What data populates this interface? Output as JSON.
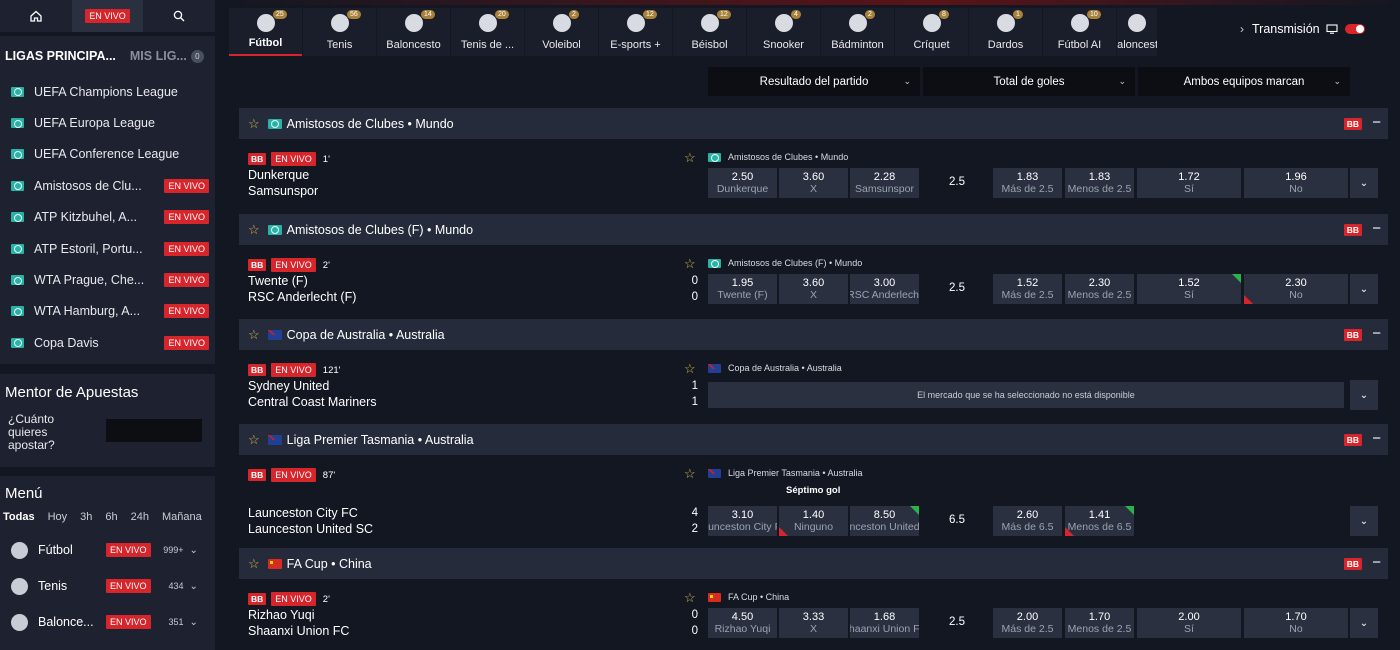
{
  "sidebar": {
    "topbar": {
      "live_label": "EN VIVO"
    },
    "tabs": {
      "active": "LIGAS PRINCIPA...",
      "inactive": "MIS LIG...",
      "count": "0"
    },
    "leagues": [
      {
        "name": "UEFA Champions League",
        "live": ""
      },
      {
        "name": "UEFA Europa League",
        "live": ""
      },
      {
        "name": "UEFA Conference League",
        "live": ""
      },
      {
        "name": "Amistosos de Clu...",
        "live": "EN VIVO"
      },
      {
        "name": "ATP Kitzbuhel, A...",
        "live": "EN VIVO"
      },
      {
        "name": "ATP Estoril, Portu...",
        "live": "EN VIVO"
      },
      {
        "name": "WTA Prague, Che...",
        "live": "EN VIVO"
      },
      {
        "name": "WTA Hamburg, A...",
        "live": "EN VIVO"
      },
      {
        "name": "Copa Davis",
        "live": "EN VIVO"
      }
    ],
    "mentor": {
      "title": "Mentor de Apuestas",
      "question": "¿Cuánto quieres apostar?",
      "value": ""
    },
    "menu": {
      "title": "Menú",
      "tabs": [
        "Todas",
        "Hoy",
        "3h",
        "6h",
        "24h",
        "Mañana"
      ],
      "items": [
        {
          "name": "Fútbol",
          "live": "EN VIVO",
          "count": "999+",
          "icon": "soccer-ball-icon"
        },
        {
          "name": "Tenis",
          "live": "EN VIVO",
          "count": "434",
          "icon": "tennis-ball-icon"
        },
        {
          "name": "Balonce...",
          "live": "EN VIVO",
          "count": "351",
          "icon": "basketball-icon"
        }
      ]
    }
  },
  "sports": [
    {
      "label": "Fútbol",
      "count": "25"
    },
    {
      "label": "Tenis",
      "count": "56"
    },
    {
      "label": "Baloncesto",
      "count": "14"
    },
    {
      "label": "Tenis de ...",
      "count": "20"
    },
    {
      "label": "Voleibol",
      "count": "2"
    },
    {
      "label": "E-sports +",
      "count": "12"
    },
    {
      "label": "Béisbol",
      "count": "12"
    },
    {
      "label": "Snooker",
      "count": "4"
    },
    {
      "label": "Bádminton",
      "count": "2"
    },
    {
      "label": "Críquet",
      "count": "8"
    },
    {
      "label": "Dardos",
      "count": "1"
    },
    {
      "label": "Fútbol AI",
      "count": "10"
    },
    {
      "label": "Baloncesto",
      "count": ""
    }
  ],
  "header": {
    "transmission": "Transmisión"
  },
  "markets": [
    "Resultado del partido",
    "Total de goles",
    "Ambos equipos marcan"
  ],
  "common": {
    "bb": "BB",
    "live": "EN VIVO"
  },
  "groups": [
    {
      "title": "Amistosos de Clubes • Mundo",
      "flag": "mundo",
      "match": {
        "time": "1'",
        "home": "Dunkerque",
        "away": "Samsunspor",
        "home_score": "",
        "away_score": "",
        "league": "Amistosos de Clubes • Mundo",
        "result": [
          {
            "odd": "2.50",
            "label": "Dunkerque"
          },
          {
            "odd": "3.60",
            "label": "X"
          },
          {
            "odd": "2.28",
            "label": "Samsunspor"
          }
        ],
        "total_line": "2.5",
        "totals": [
          {
            "odd": "1.83",
            "label": "Más de 2.5"
          },
          {
            "odd": "1.83",
            "label": "Menos de 2.5"
          }
        ],
        "btts": [
          {
            "odd": "1.72",
            "label": "Sí"
          },
          {
            "odd": "1.96",
            "label": "No"
          }
        ]
      }
    },
    {
      "title": "Amistosos de Clubes (F) • Mundo",
      "flag": "mundo",
      "match": {
        "time": "2'",
        "home": "Twente (F)",
        "away": "RSC Anderlecht (F)",
        "home_score": "0",
        "away_score": "0",
        "league": "Amistosos de Clubes (F) • Mundo",
        "result": [
          {
            "odd": "1.95",
            "label": "Twente (F)"
          },
          {
            "odd": "3.60",
            "label": "X"
          },
          {
            "odd": "3.00",
            "label": "RSC Anderlecht"
          }
        ],
        "total_line": "2.5",
        "totals": [
          {
            "odd": "1.52",
            "label": "Más de 2.5"
          },
          {
            "odd": "2.30",
            "label": "Menos de 2.5"
          }
        ],
        "btts": [
          {
            "odd": "1.52",
            "label": "Sí"
          },
          {
            "odd": "2.30",
            "label": "No"
          }
        ]
      }
    },
    {
      "title": "Copa de Australia • Australia",
      "flag": "au",
      "match": {
        "time": "121'",
        "home": "Sydney United",
        "away": "Central Coast Mariners",
        "home_score": "1",
        "away_score": "1",
        "league": "Copa de Australia • Australia",
        "unavailable": "El mercado que se ha seleccionado no está disponible"
      }
    },
    {
      "title": "Liga Premier Tasmania • Australia",
      "flag": "au",
      "match": {
        "time": "87'",
        "home": "Launceston City FC",
        "away": "Launceston United SC",
        "home_score": "4",
        "away_score": "2",
        "league": "Liga Premier Tasmania • Australia",
        "market_title": "Séptimo gol",
        "result": [
          {
            "odd": "3.10",
            "label": "Launceston City FC"
          },
          {
            "odd": "1.40",
            "label": "Ninguno"
          },
          {
            "odd": "8.50",
            "label": "Launceston United SC"
          }
        ],
        "total_line": "6.5",
        "totals": [
          {
            "odd": "2.60",
            "label": "Más de 6.5"
          },
          {
            "odd": "1.41",
            "label": "Menos de 6.5"
          }
        ]
      }
    },
    {
      "title": "FA Cup • China",
      "flag": "cn",
      "match": {
        "time": "2'",
        "home": "Rizhao Yuqi",
        "away": "Shaanxi Union FC",
        "home_score": "0",
        "away_score": "0",
        "league": "FA Cup • China",
        "result": [
          {
            "odd": "4.50",
            "label": "Rizhao Yuqi"
          },
          {
            "odd": "3.33",
            "label": "X"
          },
          {
            "odd": "1.68",
            "label": "Shaanxi Union FC"
          }
        ],
        "total_line": "2.5",
        "totals": [
          {
            "odd": "2.00",
            "label": "Más de 2.5"
          },
          {
            "odd": "1.70",
            "label": "Menos de 2.5"
          }
        ],
        "btts": [
          {
            "odd": "2.00",
            "label": "Sí"
          },
          {
            "odd": "1.70",
            "label": "No"
          }
        ]
      }
    }
  ]
}
